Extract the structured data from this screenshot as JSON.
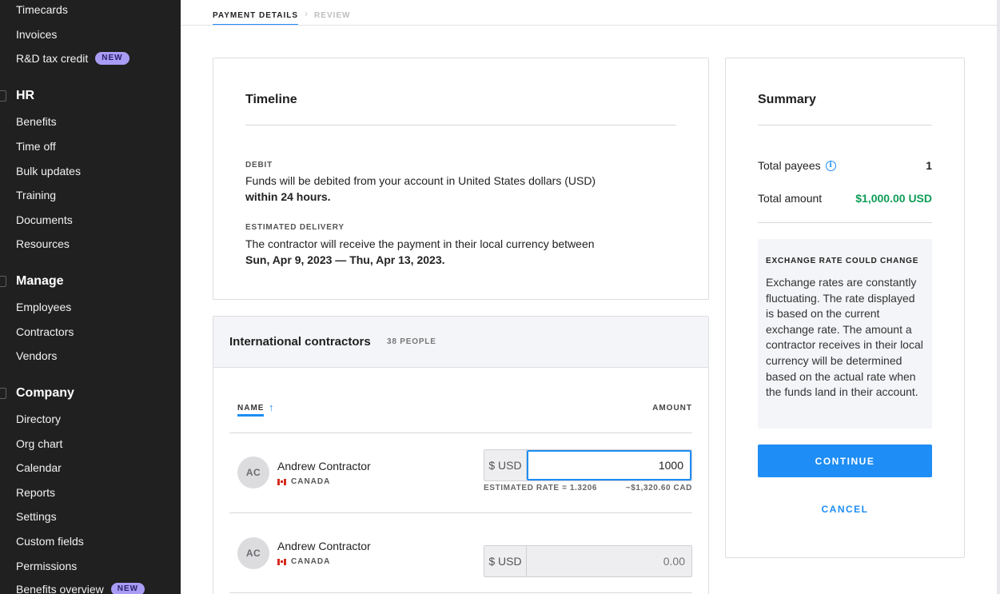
{
  "sidebar": {
    "items_top": [
      {
        "label": "Timecards"
      },
      {
        "label": "Invoices"
      },
      {
        "label": "R&D tax credit",
        "badge": "NEW"
      }
    ],
    "hr": {
      "title": "HR",
      "items": [
        {
          "label": "Benefits"
        },
        {
          "label": "Time off"
        },
        {
          "label": "Bulk updates"
        },
        {
          "label": "Training"
        },
        {
          "label": "Documents"
        },
        {
          "label": "Resources"
        }
      ]
    },
    "manage": {
      "title": "Manage",
      "items": [
        {
          "label": "Employees"
        },
        {
          "label": "Contractors"
        },
        {
          "label": "Vendors"
        }
      ]
    },
    "company": {
      "title": "Company",
      "items": [
        {
          "label": "Directory"
        },
        {
          "label": "Org chart"
        },
        {
          "label": "Calendar"
        },
        {
          "label": "Reports"
        },
        {
          "label": "Settings"
        },
        {
          "label": "Custom fields"
        },
        {
          "label": "Permissions"
        },
        {
          "label": "Benefits overview",
          "badge": "NEW"
        }
      ]
    }
  },
  "steps": {
    "current": "PAYMENT DETAILS",
    "next": "REVIEW"
  },
  "timeline": {
    "title": "Timeline",
    "debit_label": "DEBIT",
    "debit_text": "Funds will be debited from your account in United States dollars (USD)",
    "debit_bold": "within 24 hours.",
    "delivery_label": "ESTIMATED DELIVERY",
    "delivery_text": "The contractor will receive the payment in their local currency between",
    "delivery_bold": "Sun, Apr 9, 2023 — Thu, Apr 13, 2023."
  },
  "contractors": {
    "title": "International contractors",
    "count": "38 PEOPLE",
    "name_header": "NAME",
    "amount_header": "AMOUNT",
    "rows": [
      {
        "initials": "AC",
        "name": "Andrew Contractor",
        "country": "CANADA",
        "currency_prefix": "$ USD",
        "amount_value": "1000",
        "amount_placeholder": "0.00",
        "rate_label": "ESTIMATED RATE = 1.3206",
        "converted": "~$1,320.60  CAD"
      },
      {
        "initials": "AC",
        "name": "Andrew Contractor",
        "country": "CANADA",
        "currency_prefix": "$ USD",
        "amount_value": "",
        "amount_placeholder": "0.00"
      }
    ]
  },
  "summary": {
    "title": "Summary",
    "payees_label": "Total payees",
    "payees_value": "1",
    "amount_label": "Total amount",
    "amount_value": "$1,000.00 USD",
    "amount_color": "#0f9d58",
    "notice_title": "EXCHANGE RATE COULD CHANGE",
    "notice_body": "Exchange rates are constantly fluctuating. The rate displayed is based on the current exchange rate. The amount a contractor receives in their local currency will be determined based on the actual rate when the funds land in their account.",
    "continue_label": "CONTINUE",
    "cancel_label": "CANCEL"
  },
  "colors": {
    "accent": "#1e8df5",
    "sidebar_bg": "#202020",
    "badge": "#a99cf5"
  }
}
